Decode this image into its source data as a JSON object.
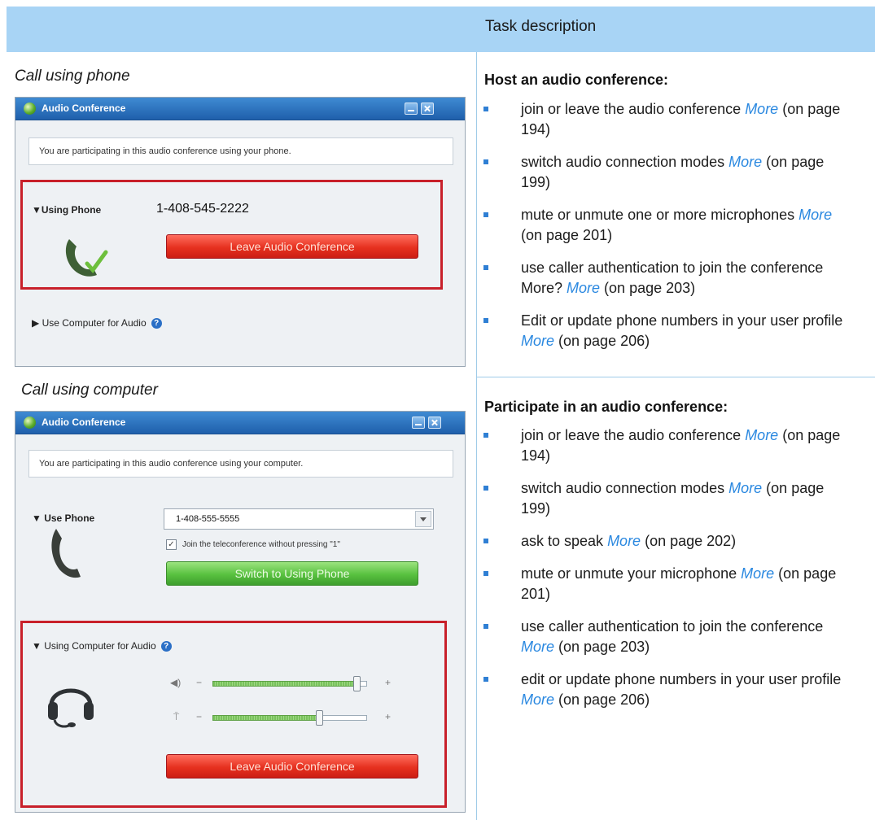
{
  "header": {
    "task_description": "Task description"
  },
  "left": {
    "caption_phone": "Call using phone",
    "caption_computer": "Call using computer",
    "window_phone": {
      "title": "Audio Conference",
      "info": "You are participating in this audio conference using your phone.",
      "section_label": "▼Using Phone",
      "phone_number": "1-408-545-2222",
      "leave_button": "Leave Audio Conference",
      "alt_section": "▶ Use Computer for Audio"
    },
    "window_computer": {
      "title": "Audio Conference",
      "info": "You are participating in this audio conference using your computer.",
      "use_phone_label": "▼ Use Phone",
      "phone_dropdown": "1-408-555-5555",
      "checkbox_label": "Join the teleconference without pressing \"1\"",
      "switch_button": "Switch to Using Phone",
      "computer_section": "▼ Using Computer for Audio",
      "speaker_level": 0.93,
      "mic_level": 0.69,
      "leave_button": "Leave Audio Conference"
    }
  },
  "right": {
    "host": {
      "heading": "Host an audio conference:",
      "items": [
        {
          "text": "join or leave the audio conference ",
          "link": "More",
          "suffix": " (on page 194)"
        },
        {
          "text": "switch audio connection modes ",
          "link": "More",
          "suffix": " (on page 199)"
        },
        {
          "text": "mute or unmute one or more microphones ",
          "link": "More",
          "suffix": " (on page 201)"
        },
        {
          "text": "use caller authentication to join the conference More? ",
          "link": "More",
          "suffix": " (on page 203)"
        },
        {
          "text": "Edit or update phone numbers in your user profile ",
          "link": "More",
          "suffix": " (on page 206)"
        }
      ]
    },
    "participate": {
      "heading": "Participate in an audio conference:",
      "items": [
        {
          "text": "join or leave the audio conference ",
          "link": "More",
          "suffix": " (on page 194)"
        },
        {
          "text": "switch audio connection modes ",
          "link": "More",
          "suffix": " (on page 199)"
        },
        {
          "text": "ask to speak ",
          "link": "More",
          "suffix": " (on page 202)"
        },
        {
          "text": "mute or unmute your microphone ",
          "link": "More",
          "suffix": " (on page 201)"
        },
        {
          "text": "use caller authentication to join the conference ",
          "link": "More",
          "suffix": " (on page 203)"
        },
        {
          "text": "edit or update phone numbers in your user profile ",
          "link": "More",
          "suffix": " (on page 206)"
        }
      ]
    }
  },
  "colors": {
    "header_bg": "#a8d4f5",
    "link": "#2a88e0",
    "bullet": "#2f7fd4",
    "highlight": "#c8202a"
  }
}
